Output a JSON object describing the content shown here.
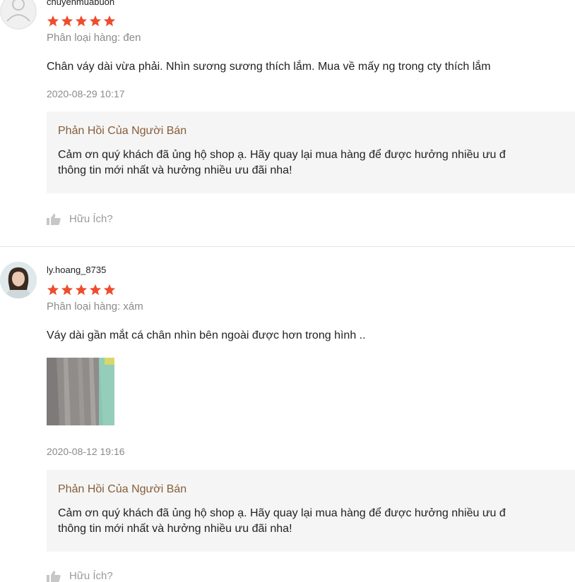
{
  "reviews": [
    {
      "username": "chuyenmuabuon",
      "rating": 5,
      "variation": "Phân loại hàng: đen",
      "comment": "Chân váy dài vừa phải. Nhìn sương sương thích lắm. Mua về mấy ng trong cty thích lắm",
      "timestamp": "2020-08-29 10:17",
      "seller_reply": {
        "title": "Phản Hồi Của Người Bán",
        "line1": "Cảm ơn quý khách đã ủng hộ shop ạ. Hãy quay lại mua hàng để được hưởng nhiều ưu đ",
        "line2": "thông tin mới nhất và hưởng nhiều ưu đãi nha!"
      },
      "helpful_label": "Hữu Ích?"
    },
    {
      "username": "ly.hoang_8735",
      "rating": 5,
      "variation": "Phân loại hàng: xám",
      "comment": "Váy dài gần mắt cá chân nhìn bên ngoài được hơn trong hình ..",
      "timestamp": "2020-08-12 19:16",
      "seller_reply": {
        "title": "Phản Hồi Của Người Bán",
        "line1": "Cảm ơn quý khách đã ủng hộ shop ạ. Hãy quay lại mua hàng để được hưởng nhiều ưu đ",
        "line2": "thông tin mới nhất và hưởng nhiều ưu đãi nha!"
      },
      "helpful_label": "Hữu Ích?"
    }
  ],
  "colors": {
    "star": "#ee4d2d",
    "reply_title": "#865d3a",
    "muted": "#8a8a8a"
  },
  "icons": {
    "star": "star-icon",
    "thumbs_up": "thumbs-up-icon",
    "default_avatar": "user-icon"
  }
}
